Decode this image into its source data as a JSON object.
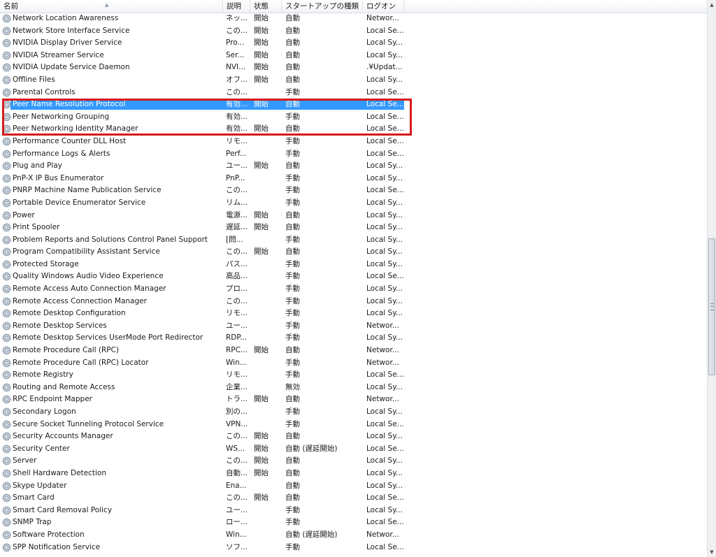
{
  "columns": {
    "name": "名前",
    "description": "説明",
    "status": "状態",
    "startup": "スタートアップの種類",
    "logon": "ログオン"
  },
  "icons": {
    "service": "gear-icon",
    "sort": "sort-ascending-icon"
  },
  "colors": {
    "selection": "#3399ff",
    "annotation_box": "#d7191c"
  },
  "services": [
    {
      "name": "Network Location Awareness",
      "desc": "ネッ...",
      "status": "開始",
      "startup": "自動",
      "logon": "Networ..."
    },
    {
      "name": "Network Store Interface Service",
      "desc": "この...",
      "status": "開始",
      "startup": "自動",
      "logon": "Local Se..."
    },
    {
      "name": "NVIDIA Display Driver Service",
      "desc": "Pro...",
      "status": "開始",
      "startup": "自動",
      "logon": "Local Sy..."
    },
    {
      "name": "NVIDIA Streamer Service",
      "desc": "Ser...",
      "status": "開始",
      "startup": "自動",
      "logon": "Local Sy..."
    },
    {
      "name": "NVIDIA Update Service Daemon",
      "desc": "NVI...",
      "status": "開始",
      "startup": "自動",
      "logon": ".¥Updat..."
    },
    {
      "name": "Offline Files",
      "desc": "オフ...",
      "status": "開始",
      "startup": "自動",
      "logon": "Local Sy..."
    },
    {
      "name": "Parental Controls",
      "desc": "この...",
      "status": "",
      "startup": "手動",
      "logon": "Local Se..."
    },
    {
      "name": "Peer Name Resolution Protocol",
      "desc": "有効...",
      "status": "開始",
      "startup": "自動",
      "logon": "Local Se...",
      "selected": true
    },
    {
      "name": "Peer Networking Grouping",
      "desc": "有効...",
      "status": "",
      "startup": "手動",
      "logon": "Local Se..."
    },
    {
      "name": "Peer Networking Identity Manager",
      "desc": "有効...",
      "status": "開始",
      "startup": "自動",
      "logon": "Local Se..."
    },
    {
      "name": "Performance Counter DLL Host",
      "desc": "リモ...",
      "status": "",
      "startup": "手動",
      "logon": "Local Se..."
    },
    {
      "name": "Performance Logs & Alerts",
      "desc": "Perf...",
      "status": "",
      "startup": "手動",
      "logon": "Local Se..."
    },
    {
      "name": "Plug and Play",
      "desc": "ユー...",
      "status": "開始",
      "startup": "自動",
      "logon": "Local Sy..."
    },
    {
      "name": "PnP-X IP Bus Enumerator",
      "desc": "PnP...",
      "status": "",
      "startup": "手動",
      "logon": "Local Sy..."
    },
    {
      "name": "PNRP Machine Name Publication Service",
      "desc": "この...",
      "status": "",
      "startup": "手動",
      "logon": "Local Se..."
    },
    {
      "name": "Portable Device Enumerator Service",
      "desc": "リム...",
      "status": "",
      "startup": "手動",
      "logon": "Local Sy..."
    },
    {
      "name": "Power",
      "desc": "電源...",
      "status": "開始",
      "startup": "自動",
      "logon": "Local Sy..."
    },
    {
      "name": "Print Spooler",
      "desc": "遅延...",
      "status": "開始",
      "startup": "自動",
      "logon": "Local Sy..."
    },
    {
      "name": "Problem Reports and Solutions Control Panel Support",
      "desc": "[問...",
      "status": "",
      "startup": "手動",
      "logon": "Local Sy..."
    },
    {
      "name": "Program Compatibility Assistant Service",
      "desc": "この...",
      "status": "開始",
      "startup": "自動",
      "logon": "Local Sy..."
    },
    {
      "name": "Protected Storage",
      "desc": "パス...",
      "status": "",
      "startup": "手動",
      "logon": "Local Sy..."
    },
    {
      "name": "Quality Windows Audio Video Experience",
      "desc": "高品...",
      "status": "",
      "startup": "手動",
      "logon": "Local Se..."
    },
    {
      "name": "Remote Access Auto Connection Manager",
      "desc": "プロ...",
      "status": "",
      "startup": "手動",
      "logon": "Local Sy..."
    },
    {
      "name": "Remote Access Connection Manager",
      "desc": "この...",
      "status": "",
      "startup": "手動",
      "logon": "Local Sy..."
    },
    {
      "name": "Remote Desktop Configuration",
      "desc": "リモ...",
      "status": "",
      "startup": "手動",
      "logon": "Local Sy..."
    },
    {
      "name": "Remote Desktop Services",
      "desc": "ユー...",
      "status": "",
      "startup": "手動",
      "logon": "Networ..."
    },
    {
      "name": "Remote Desktop Services UserMode Port Redirector",
      "desc": "RDP...",
      "status": "",
      "startup": "手動",
      "logon": "Local Sy..."
    },
    {
      "name": "Remote Procedure Call (RPC)",
      "desc": "RPC...",
      "status": "開始",
      "startup": "自動",
      "logon": "Networ..."
    },
    {
      "name": "Remote Procedure Call (RPC) Locator",
      "desc": "Win...",
      "status": "",
      "startup": "手動",
      "logon": "Networ..."
    },
    {
      "name": "Remote Registry",
      "desc": "リモ...",
      "status": "",
      "startup": "手動",
      "logon": "Local Se..."
    },
    {
      "name": "Routing and Remote Access",
      "desc": "企業...",
      "status": "",
      "startup": "無効",
      "logon": "Local Sy..."
    },
    {
      "name": "RPC Endpoint Mapper",
      "desc": "トラ...",
      "status": "開始",
      "startup": "自動",
      "logon": "Networ..."
    },
    {
      "name": "Secondary Logon",
      "desc": "別の...",
      "status": "",
      "startup": "手動",
      "logon": "Local Sy..."
    },
    {
      "name": "Secure Socket Tunneling Protocol Service",
      "desc": "VPN...",
      "status": "",
      "startup": "手動",
      "logon": "Local Se..."
    },
    {
      "name": "Security Accounts Manager",
      "desc": "この...",
      "status": "開始",
      "startup": "自動",
      "logon": "Local Sy..."
    },
    {
      "name": "Security Center",
      "desc": "WS...",
      "status": "開始",
      "startup": "自動 (遅延開始)",
      "logon": "Local Se..."
    },
    {
      "name": "Server",
      "desc": "この...",
      "status": "開始",
      "startup": "自動",
      "logon": "Local Sy..."
    },
    {
      "name": "Shell Hardware Detection",
      "desc": "自動...",
      "status": "開始",
      "startup": "自動",
      "logon": "Local Sy..."
    },
    {
      "name": "Skype Updater",
      "desc": "Ena...",
      "status": "",
      "startup": "自動",
      "logon": "Local Sy..."
    },
    {
      "name": "Smart Card",
      "desc": "この...",
      "status": "開始",
      "startup": "自動",
      "logon": "Local Se..."
    },
    {
      "name": "Smart Card Removal Policy",
      "desc": "ユー...",
      "status": "",
      "startup": "手動",
      "logon": "Local Sy..."
    },
    {
      "name": "SNMP Trap",
      "desc": "ロー...",
      "status": "",
      "startup": "手動",
      "logon": "Local Se..."
    },
    {
      "name": "Software Protection",
      "desc": "Win...",
      "status": "",
      "startup": "自動 (遅延開始)",
      "logon": "Networ..."
    },
    {
      "name": "SPP Notification Service",
      "desc": "ソフ...",
      "status": "",
      "startup": "手動",
      "logon": "Local Se..."
    }
  ]
}
